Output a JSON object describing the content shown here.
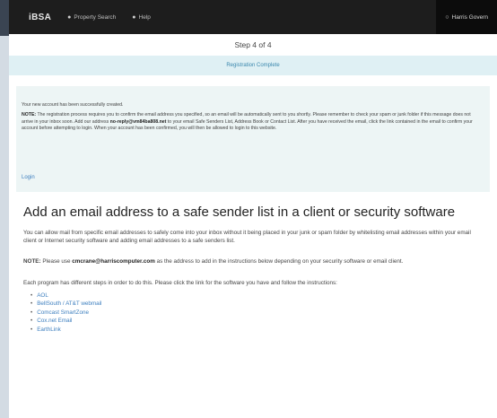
{
  "navbar": {
    "brand": "iBSA",
    "items": [
      {
        "label": "Property Search",
        "icon": "globe-icon"
      },
      {
        "label": "Help",
        "icon": "help-circle-icon"
      }
    ],
    "user": {
      "label": "Harris Govern",
      "icon": "user-circle-icon"
    }
  },
  "step": "Step 4 of 4",
  "status_banner": "Registration Complete",
  "panel": {
    "created": "Your new account has been successfully created.",
    "note_label": "NOTE:",
    "note_before": " The registration process requires you to confirm the email address you specified, so an email will be automatically sent to you shortly. Please remember to check your spam or junk folder if this message does not arrive in your inbox soon. Add our address ",
    "note_address": "no-reply@vm84ba808.net",
    "note_after": " to your email Safe Senders List, Address Book or Contact List. After you have received the email, click the link contained in the email to confirm your account before attempting to login. When your account has been confirmed, you will then be allowed to login to this website.",
    "login_link": "Login"
  },
  "main": {
    "heading": "Add an email address to a safe sender list in a client or security software",
    "intro": "You can allow mail from specific email addresses to safely come into your inbox without it being placed in your junk or spam folder by whitelisting email addresses within your email client or Internet security software and adding email addresses to a safe senders list.",
    "note_label": "NOTE:",
    "note_prefix": " Please use ",
    "note_email": "cmcrane@harriscomputer.com",
    "note_suffix": " as the address to add in the instructions below depending on your security software or email client.",
    "instructions": "Each program has different steps in order to do this. Please click the link for the software you have and follow the instructions:",
    "links": [
      "AOL",
      "BellSouth / AT&T webmail",
      "Comcast SmartZone",
      "Cox.net Email",
      "EarthLink"
    ]
  },
  "colors": {
    "navbar": "#1d1d1d",
    "banner_bg": "#dff0f4",
    "banner_text": "#3a87ad",
    "panel_bg": "#edf5f5",
    "link": "#3d7fbf"
  }
}
